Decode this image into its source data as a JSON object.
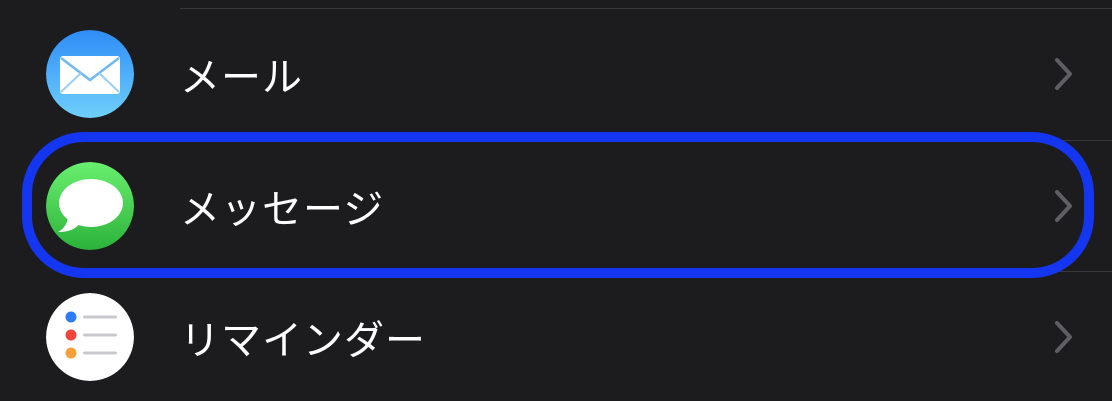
{
  "settings_list": {
    "items": [
      {
        "label": "メール",
        "icon": "mail-icon"
      },
      {
        "label": "メッセージ",
        "icon": "messages-icon"
      },
      {
        "label": "リマインダー",
        "icon": "reminders-icon"
      }
    ]
  },
  "colors": {
    "background": "#1c1c1e",
    "separator": "#38383a",
    "highlight_outline": "#1436f0",
    "chevron": "#5e5e63",
    "mail_icon_top": "#2e8cf7",
    "mail_icon_bottom": "#6fd0fb",
    "messages_icon_top": "#6af06f",
    "messages_icon_bottom": "#2bb23a",
    "reminders_dot_blue": "#2f7cf6",
    "reminders_dot_red": "#f0453a",
    "reminders_dot_orange": "#f5a03a"
  }
}
